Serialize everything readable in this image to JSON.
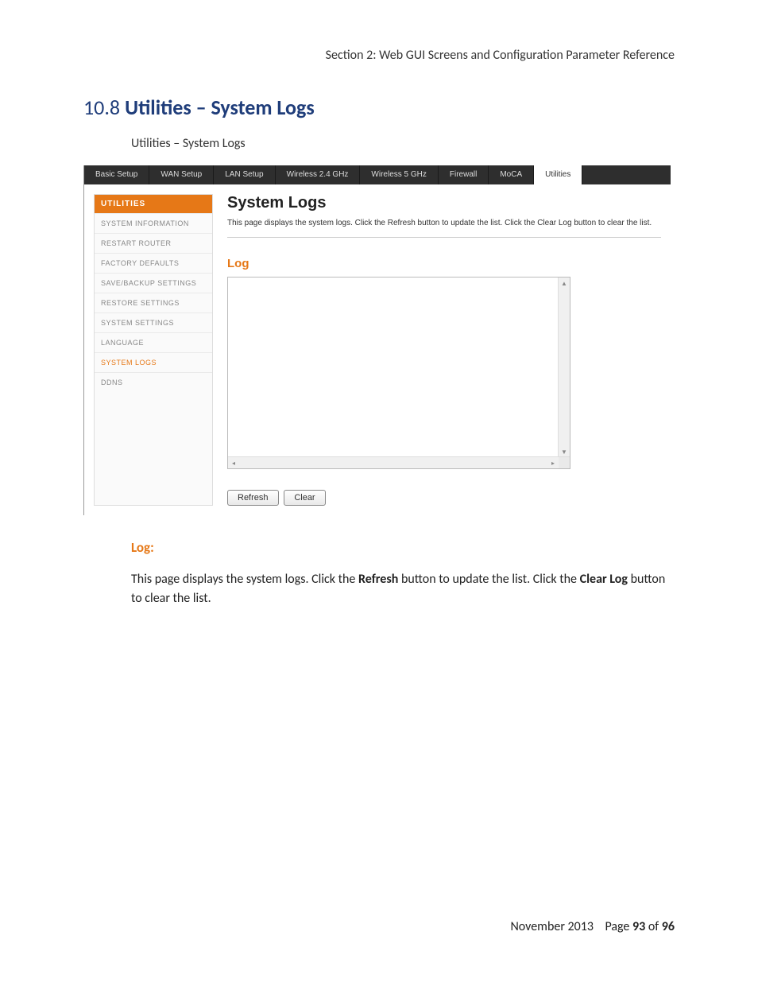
{
  "section_header": "Section 2:  Web GUI Screens and Configuration Parameter Reference",
  "heading_number": "10.8",
  "heading_title": "Utilities – System Logs",
  "subheading": "Utilities – System Logs",
  "topnav": {
    "tabs": [
      {
        "label": "Basic Setup"
      },
      {
        "label": "WAN Setup"
      },
      {
        "label": "LAN Setup"
      },
      {
        "label": "Wireless 2.4 GHz"
      },
      {
        "label": "Wireless 5 GHz"
      },
      {
        "label": "Firewall"
      },
      {
        "label": "MoCA"
      },
      {
        "label": "Utilities",
        "active": true
      }
    ]
  },
  "sidebar": {
    "header": "UTILITIES",
    "items": [
      {
        "label": "SYSTEM INFORMATION"
      },
      {
        "label": "RESTART ROUTER"
      },
      {
        "label": "FACTORY DEFAULTS"
      },
      {
        "label": "SAVE/BACKUP SETTINGS"
      },
      {
        "label": "RESTORE SETTINGS"
      },
      {
        "label": "SYSTEM SETTINGS"
      },
      {
        "label": "LANGUAGE"
      },
      {
        "label": "SYSTEM LOGS",
        "active": true
      },
      {
        "label": "DDNS"
      }
    ]
  },
  "content": {
    "title": "System Logs",
    "description": "This page displays the system logs. Click the Refresh button to update the list. Click the Clear Log button to clear the list.",
    "log_label": "Log",
    "buttons": {
      "refresh": "Refresh",
      "clear": "Clear"
    }
  },
  "doc": {
    "log_heading": "Log:",
    "para_prefix": "This page displays the system logs.  Click the ",
    "para_b1": "Refresh",
    "para_mid": " button to update the list.  Click the ",
    "para_b2": "Clear Log",
    "para_suffix": " button to clear the list."
  },
  "footer": {
    "date": "November 2013",
    "page_label": "Page ",
    "page_current": "93",
    "page_of": " of ",
    "page_total": "96"
  }
}
